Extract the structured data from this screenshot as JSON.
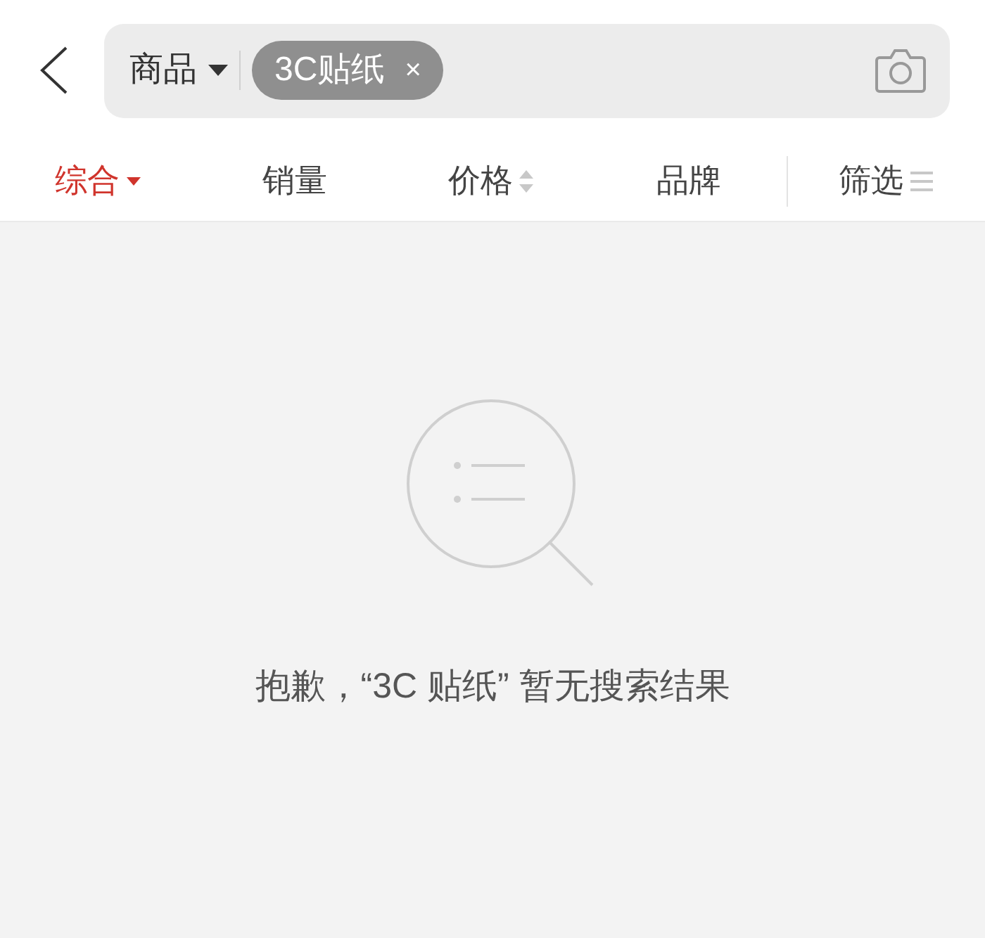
{
  "search": {
    "scope": "商品",
    "tag": "3C贴纸",
    "tag_remove": "×"
  },
  "tabs": [
    {
      "label": "综合",
      "kind": "dropdown",
      "selected": true
    },
    {
      "label": "销量",
      "kind": "plain",
      "selected": false
    },
    {
      "label": "价格",
      "kind": "sort",
      "selected": false
    },
    {
      "label": "品牌",
      "kind": "plain",
      "selected": false
    },
    {
      "label": "筛选",
      "kind": "filter",
      "selected": false
    }
  ],
  "empty": {
    "message": "抱歉，“3C 贴纸” 暂无搜索结果"
  }
}
